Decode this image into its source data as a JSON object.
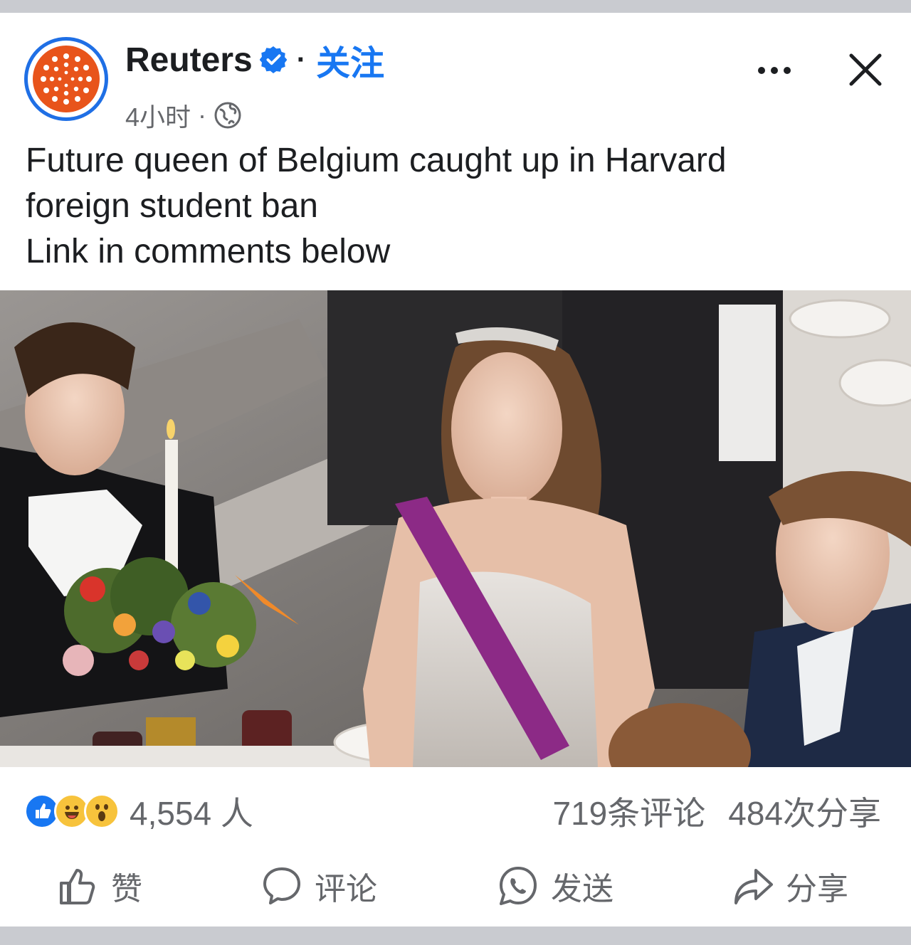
{
  "post": {
    "page_name": "Reuters",
    "separator": "·",
    "follow_label": "关注",
    "time": "4小时",
    "meta_separator": "·",
    "text_lines": [
      "Future queen of Belgium caught up in Harvard",
      "foreign student ban",
      "Link in comments below"
    ]
  },
  "icons": {
    "avatar": "reuters-logo",
    "verified": "verified-badge-icon",
    "audience": "globe-icon",
    "more": "more-options-icon",
    "close": "close-icon"
  },
  "counts": {
    "reactions": "4,554 人",
    "comments": "719条评论",
    "shares": "484次分享"
  },
  "actions": {
    "like": "赞",
    "comment": "评论",
    "send": "发送",
    "share": "分享"
  },
  "colors": {
    "brand_blue": "#1877f2",
    "reuters_orange": "#e8541b",
    "secondary_text": "#65676b",
    "sash_purple": "#8c2a86"
  }
}
